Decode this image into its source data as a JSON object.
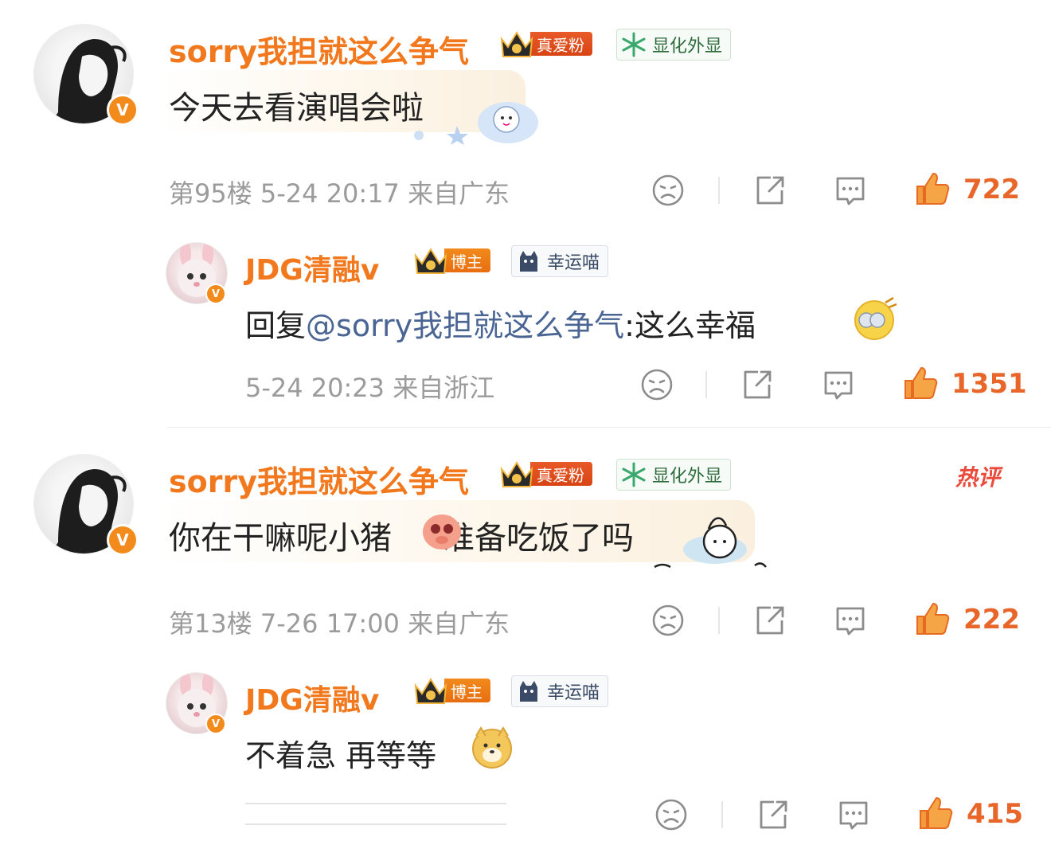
{
  "comments": [
    {
      "user": "sorry我担就这么争气",
      "fan_badge": "真爱粉",
      "title_badge": "显化外显",
      "text": "今天去看演唱会啦",
      "meta": "第95楼 5-24 20:17 来自广东",
      "likes": "722",
      "reply": {
        "user": "JDG清融v",
        "fan_badge": "博主",
        "title_badge": "幸运喵",
        "prefix": "回复",
        "mention": "@sorry我担就这么争气",
        "text": ":这么幸福",
        "meta": "5-24 20:23 来自浙江",
        "likes": "1351"
      }
    },
    {
      "user": "sorry我担就这么争气",
      "fan_badge": "真爱粉",
      "title_badge": "显化外显",
      "hot_label": "热评",
      "text_part1": "你在干嘛呢小猪",
      "text_part2": "准备吃饭了吗",
      "meta": "第13楼 7-26 17:00 来自广东",
      "likes": "222",
      "reply": {
        "user": "JDG清融v",
        "fan_badge": "博主",
        "title_badge": "幸运喵",
        "text": "不着急 再等等",
        "likes": "415"
      }
    }
  ],
  "colors": {
    "username": "#f2781d",
    "mention": "#4a6594",
    "meta": "#9b9b9b",
    "likes": "#e8662a",
    "fan_badge": "#d84414"
  },
  "icons": {
    "verified": "V",
    "dislike": "sad-face-icon",
    "share": "share-icon",
    "comment": "comment-icon",
    "like": "thumbs-up-icon"
  }
}
